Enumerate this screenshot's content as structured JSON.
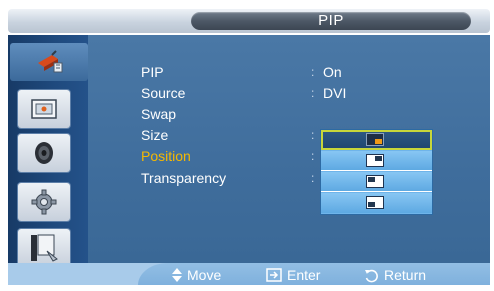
{
  "title": "PIP",
  "sidebar": {
    "items": [
      {
        "icon": "input-plug-icon",
        "active": true
      },
      {
        "icon": "picture-icon",
        "active": false
      },
      {
        "icon": "speaker-icon",
        "active": false
      },
      {
        "icon": "setup-gear-icon",
        "active": false
      },
      {
        "icon": "multi-control-icon",
        "active": false
      }
    ]
  },
  "menu": {
    "items": [
      {
        "label": "PIP",
        "value": "On",
        "highlighted": false
      },
      {
        "label": "Source",
        "value": "DVI",
        "highlighted": false
      },
      {
        "label": "Swap",
        "value": "",
        "highlighted": false
      },
      {
        "label": "Size",
        "value": "",
        "highlighted": false
      },
      {
        "label": "Position",
        "value": "",
        "highlighted": true
      },
      {
        "label": "Transparency",
        "value": "",
        "highlighted": false
      }
    ],
    "colon": ":"
  },
  "position_options": {
    "selected_index": 0,
    "options": [
      {
        "icon": "pip-bottom-right-icon"
      },
      {
        "icon": "pip-top-right-icon"
      },
      {
        "icon": "pip-top-left-icon"
      },
      {
        "icon": "pip-bottom-left-icon"
      }
    ]
  },
  "footer": {
    "move": "Move",
    "enter": "Enter",
    "return": "Return"
  },
  "colors": {
    "highlight": "#f5b800",
    "panel": "#4274a2",
    "sidebar": "#1f4a7e",
    "selected_pip": "#f09a16"
  }
}
